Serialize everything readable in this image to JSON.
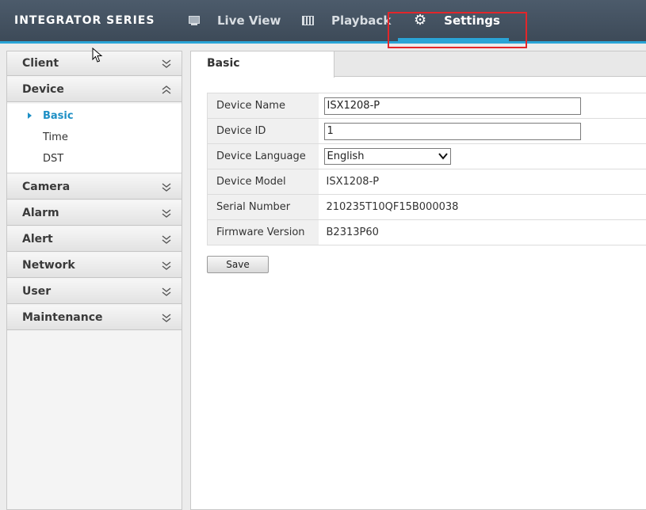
{
  "header": {
    "brand": "INTEGRATOR SERIES",
    "tabs": [
      {
        "label": "Live View",
        "icon": "monitor-icon"
      },
      {
        "label": "Playback",
        "icon": "film-icon"
      },
      {
        "label": "Settings",
        "icon": "gear-icon",
        "active": true
      }
    ],
    "accent_color": "#2aa4d6",
    "highlight_color": "#e3262a"
  },
  "sidebar": {
    "sections": [
      {
        "label": "Client",
        "expanded": false
      },
      {
        "label": "Device",
        "expanded": true,
        "items": [
          "Basic",
          "Time",
          "DST"
        ],
        "active_item": "Basic"
      },
      {
        "label": "Camera",
        "expanded": false
      },
      {
        "label": "Alarm",
        "expanded": false
      },
      {
        "label": "Alert",
        "expanded": false
      },
      {
        "label": "Network",
        "expanded": false
      },
      {
        "label": "User",
        "expanded": false
      },
      {
        "label": "Maintenance",
        "expanded": false
      }
    ]
  },
  "main": {
    "tab_label": "Basic",
    "fields": {
      "device_name": {
        "label": "Device Name",
        "value": "ISX1208-P"
      },
      "device_id": {
        "label": "Device ID",
        "value": "1"
      },
      "device_language": {
        "label": "Device Language",
        "value": "English"
      },
      "device_model": {
        "label": "Device Model",
        "value": "ISX1208-P"
      },
      "serial_number": {
        "label": "Serial Number",
        "value": "210235T10QF15B000038"
      },
      "firmware_version": {
        "label": "Firmware Version",
        "value": "B2313P60"
      }
    },
    "save_label": "Save"
  }
}
